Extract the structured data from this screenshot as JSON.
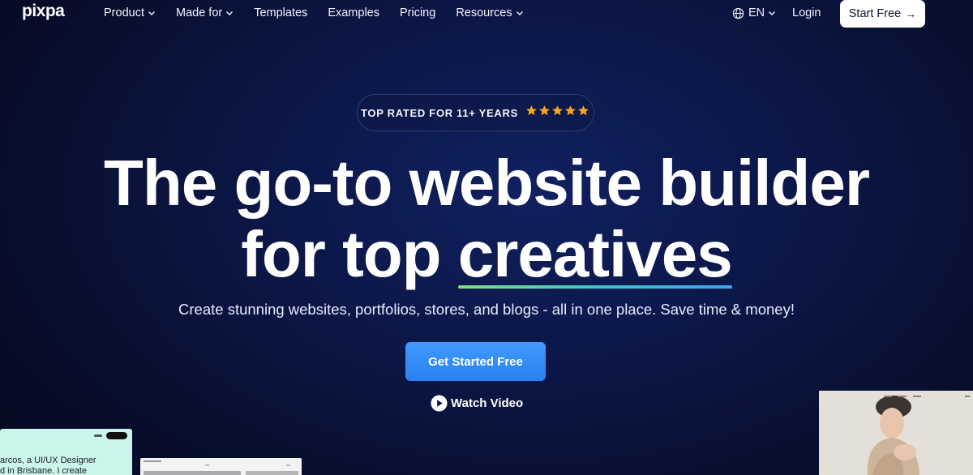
{
  "nav": {
    "logo": "pixpa",
    "items": [
      {
        "label": "Product",
        "dropdown": true
      },
      {
        "label": "Made for",
        "dropdown": true
      },
      {
        "label": "Templates",
        "dropdown": false
      },
      {
        "label": "Examples",
        "dropdown": false
      },
      {
        "label": "Pricing",
        "dropdown": false
      },
      {
        "label": "Resources",
        "dropdown": true
      }
    ],
    "language": "EN",
    "login": "Login",
    "start_free": "Start Free",
    "start_free_icon": "arrow-right-icon"
  },
  "badge": {
    "text": "TOP RATED FOR 11+ YEARS",
    "stars": 5,
    "star_color": "#f5a623"
  },
  "hero": {
    "line1": "The go-to website builder",
    "line2_prefix": "for top ",
    "line2_highlight": "creatives",
    "subtitle": "Create stunning websites, portfolios, stores, and blogs - all in one place. Save time & money!",
    "cta": "Get Started Free",
    "watch_video": "Watch Video"
  },
  "previews": {
    "left_text_line1": "arcos, a UI/UX Designer",
    "left_text_line2": "d in Brisbane. I create"
  },
  "colors": {
    "background": "#0b1644",
    "cta": "#2f8af5",
    "underline_start": "#7fe27a",
    "underline_end": "#3ea4f5"
  }
}
